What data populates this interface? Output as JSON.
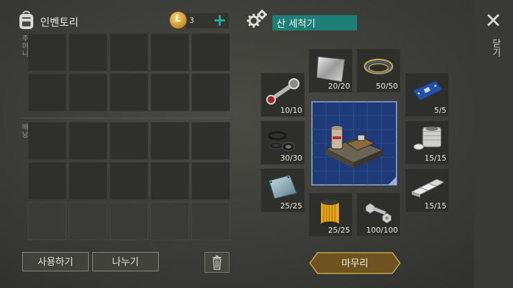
{
  "inventory": {
    "title": "인벤토리",
    "coin_count": "3",
    "pocket_label": "주머니",
    "backpack_label": "배낭"
  },
  "crafting": {
    "title": "산 세척기",
    "finish_label": "마무리",
    "ingredients": [
      {
        "name": "metal-plate",
        "qty": "20/20"
      },
      {
        "name": "wire",
        "qty": "50/50"
      },
      {
        "name": "connecting-rod",
        "qty": "10/10"
      },
      {
        "name": "circuit-board",
        "qty": "5/5"
      },
      {
        "name": "rubber-seals",
        "qty": "30/30"
      },
      {
        "name": "engine-cylinder",
        "qty": "15/15"
      },
      {
        "name": "glass-panel",
        "qty": "25/25"
      },
      {
        "name": "aluminum-ingots",
        "qty": "15/15"
      },
      {
        "name": "oil-filter",
        "qty": "25/25"
      },
      {
        "name": "bolt-and-nut",
        "qty": "100/100"
      }
    ]
  },
  "buttons": {
    "use": "사용하기",
    "split": "나누기"
  },
  "close_label": "닫기",
  "colors": {
    "accent": "#1d7f78",
    "plus": "#1fb9a4",
    "finish_button": "#7a5a1f"
  }
}
